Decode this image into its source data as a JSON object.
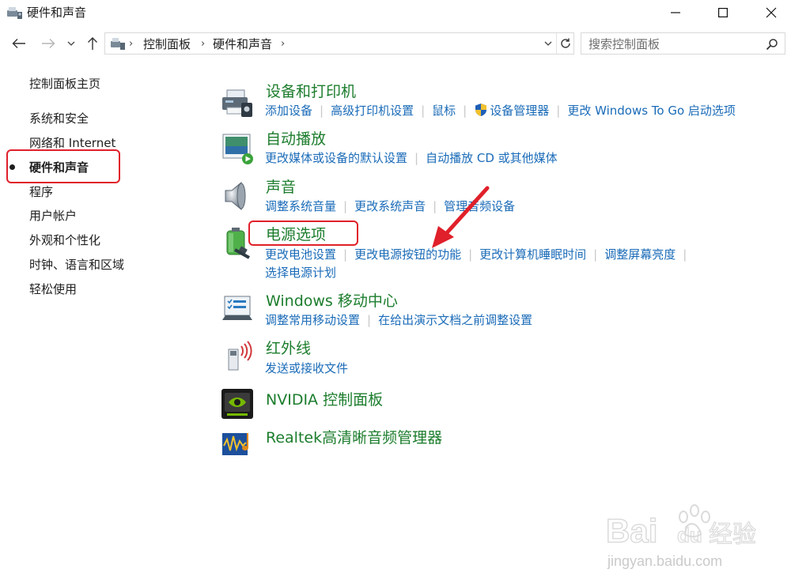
{
  "window": {
    "title": "硬件和声音",
    "controls": {
      "minimize": "—",
      "maximize": "☐",
      "close": "✕"
    }
  },
  "address": {
    "crumbs": [
      "控制面板",
      "硬件和声音"
    ],
    "search_placeholder": "搜索控制面板"
  },
  "sidebar": {
    "home": "控制面板主页",
    "items": [
      "系统和安全",
      "网络和 Internet",
      "硬件和声音",
      "程序",
      "用户帐户",
      "外观和个性化",
      "时钟、语言和区域",
      "轻松使用"
    ]
  },
  "categories": [
    {
      "title": "设备和打印机",
      "icon": "printer-icon",
      "links": [
        "添加设备",
        "高级打印机设置",
        "鼠标",
        "设备管理器",
        "更改 Windows To Go 启动选项"
      ]
    },
    {
      "title": "自动播放",
      "icon": "autoplay-icon",
      "links": [
        "更改媒体或设备的默认设置",
        "自动播放 CD 或其他媒体"
      ]
    },
    {
      "title": "声音",
      "icon": "speaker-icon",
      "links": [
        "调整系统音量",
        "更改系统声音",
        "管理音频设备"
      ]
    },
    {
      "title": "电源选项",
      "icon": "battery-plug-icon",
      "links": [
        "更改电池设置",
        "更改电源按钮的功能",
        "更改计算机睡眠时间",
        "调整屏幕亮度",
        "选择电源计划"
      ]
    },
    {
      "title": "Windows 移动中心",
      "icon": "mobility-center-icon",
      "links": [
        "调整常用移动设置",
        "在给出演示文档之前调整设置"
      ]
    },
    {
      "title": "红外线",
      "icon": "infrared-icon",
      "links": [
        "发送或接收文件"
      ]
    },
    {
      "title": "NVIDIA 控制面板",
      "icon": "nvidia-icon",
      "links": []
    },
    {
      "title": "Realtek高清晰音频管理器",
      "icon": "realtek-audio-icon",
      "links": []
    }
  ],
  "watermark": {
    "brand": "Bai du 经验",
    "url": "jingyan.baidu.com"
  },
  "colors": {
    "category_title": "#1c7d2d",
    "link": "#1a6bb8",
    "highlight_box": "#e0202a",
    "arrow": "#e0202a"
  }
}
